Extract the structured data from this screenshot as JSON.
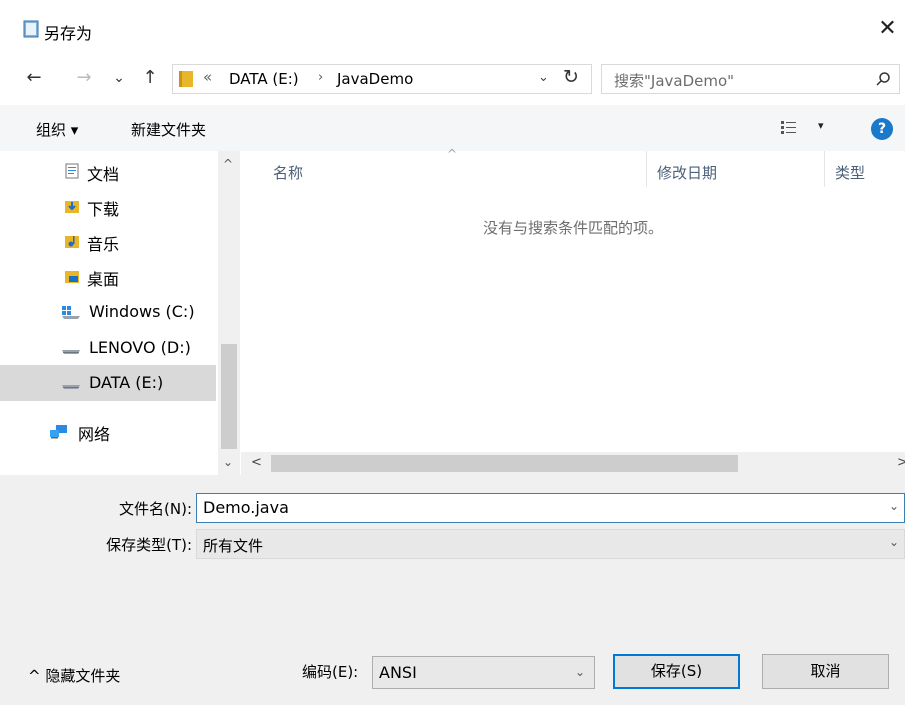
{
  "window": {
    "title": "另存为",
    "close_glyph": "✕"
  },
  "nav": {
    "back_glyph": "←",
    "forward_glyph": "→",
    "recent_glyph": "⌄",
    "up_glyph": "↑",
    "path_chevron": "«",
    "path": [
      "DATA (E:)",
      "JavaDemo"
    ],
    "path_sep": "›",
    "dropdown_glyph": "⌄",
    "refresh_glyph": "↻",
    "search_placeholder": "搜索\"JavaDemo\""
  },
  "toolbar": {
    "organize": "组织 ▾",
    "new_folder": "新建文件夹",
    "view_dropdown": "▾",
    "help": "?"
  },
  "sidebar": {
    "scroll_up": "^",
    "scroll_down": "⌄",
    "items": [
      {
        "label": "文档",
        "icon": "documents-icon"
      },
      {
        "label": "下载",
        "icon": "downloads-icon"
      },
      {
        "label": "音乐",
        "icon": "music-icon"
      },
      {
        "label": "桌面",
        "icon": "desktop-icon"
      },
      {
        "label": "Windows (C:)",
        "icon": "windows-drive-icon"
      },
      {
        "label": "LENOVO (D:)",
        "icon": "drive-icon"
      },
      {
        "label": "DATA (E:)",
        "icon": "drive-icon",
        "selected": true
      },
      {
        "label": "网络",
        "icon": "network-icon"
      }
    ]
  },
  "file_list": {
    "columns": [
      "名称",
      "修改日期",
      "类型"
    ],
    "sort_glyph": "^",
    "empty_message": "没有与搜索条件匹配的项。",
    "scroll_left": "<",
    "scroll_right": ">"
  },
  "form": {
    "filename_label": "文件名(N):",
    "filename_value": "Demo.java",
    "filetype_label": "保存类型(T):",
    "filetype_value": "所有文件",
    "dropdown_glyph": "⌄",
    "hide_folders": "^ 隐藏文件夹",
    "encoding_label": "编码(E):",
    "encoding_value": "ANSI",
    "save_button": "保存(S)",
    "cancel_button": "取消"
  },
  "colors": {
    "accent": "#0078d7",
    "selection": "#d9d9d9",
    "folder": "#e8b628"
  }
}
